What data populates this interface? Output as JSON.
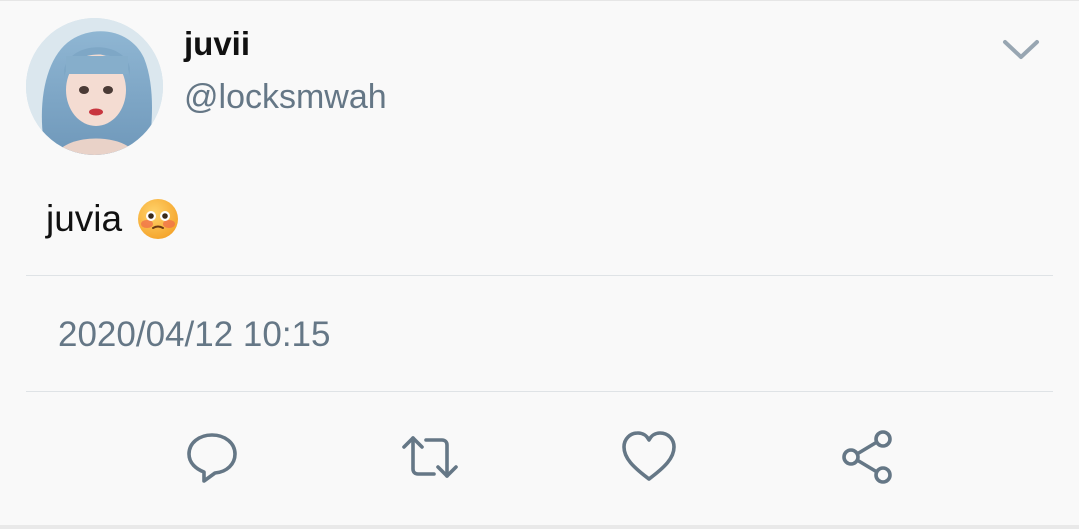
{
  "tweet": {
    "display_name": "juvii",
    "handle": "@locksmwah",
    "text": "juvia",
    "emoji": "flushed-face-emoji",
    "timestamp": "2020/04/12 10:15"
  },
  "icons": {
    "menu": "chevron-down-icon",
    "reply": "reply-icon",
    "retweet": "retweet-icon",
    "like": "heart-icon",
    "share": "share-icon"
  },
  "colors": {
    "text_primary": "#111111",
    "text_secondary": "#657786",
    "icon": "#657786",
    "background": "#f9f9f9",
    "divider": "#dfe3e6"
  }
}
